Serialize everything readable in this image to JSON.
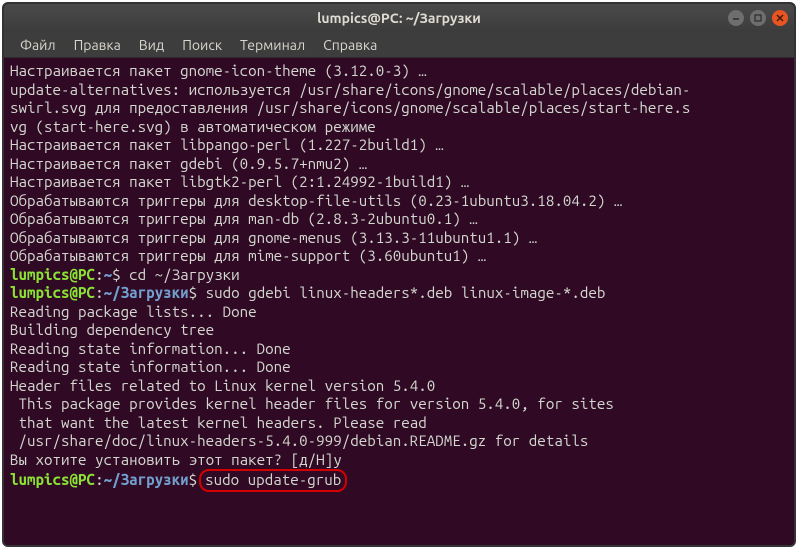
{
  "window": {
    "title": "lumpics@PC: ~/Загрузки"
  },
  "menubar": {
    "items": [
      "Файл",
      "Правка",
      "Вид",
      "Поиск",
      "Терминал",
      "Справка"
    ]
  },
  "output": {
    "l1": "Настраивается пакет gnome-icon-theme (3.12.0-3) …",
    "l2": "update-alternatives: используется /usr/share/icons/gnome/scalable/places/debian-",
    "l3": "swirl.svg для предоставления /usr/share/icons/gnome/scalable/places/start-here.s",
    "l4": "vg (start-here.svg) в автоматическом режиме",
    "l5": "Настраивается пакет libpango-perl (1.227-2build1) …",
    "l6": "Настраивается пакет gdebi (0.9.5.7+nmu2) …",
    "l7": "Настраивается пакет libgtk2-perl (2:1.24992-1build1) …",
    "l8": "Обрабатываются триггеры для desktop-file-utils (0.23-1ubuntu3.18.04.2) …",
    "l9": "Обрабатываются триггеры для man-db (2.8.3-2ubuntu0.1) …",
    "l10": "Обрабатываются триггеры для gnome-menus (3.13.3-11ubuntu1.1) …",
    "l11": "Обрабатываются триггеры для mime-support (3.60ubuntu1) …",
    "l12_cmd": "cd ~/Загрузки",
    "l13_cmd": "sudo gdebi linux-headers*.deb linux-image-*.deb",
    "l14": "Reading package lists... Done",
    "l15": "Building dependency tree",
    "l16": "Reading state information... Done",
    "l17": "Reading state information... Done",
    "l18": "",
    "l19": "Header files related to Linux kernel version 5.4.0",
    "l20": " This package provides kernel header files for version 5.4.0, for sites",
    "l21": " that want the latest kernel headers. Please read",
    "l22": " /usr/share/doc/linux-headers-5.4.0-999/debian.README.gz for details",
    "l23": "Вы хотите установить этот пакет? [д/Н]y",
    "l24_cmd": "sudo update-grub"
  },
  "prompt": {
    "userhost": "lumpics@PC",
    "path_home": "~",
    "path_dl": "~/Загрузки",
    "dollar": "$"
  }
}
